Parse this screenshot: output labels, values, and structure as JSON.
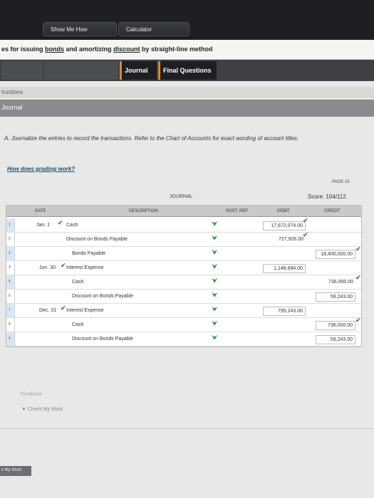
{
  "topbar": {
    "show_me_how": "Show Me How",
    "calculator": "Calculator"
  },
  "title": {
    "prefix": "es for issuing ",
    "bonds": "bonds",
    "middle": " and amortizing ",
    "discount": "discount",
    "suffix": " by straight-line method"
  },
  "tabs": [
    {
      "label": ""
    },
    {
      "label": ""
    },
    {
      "label": "Journal"
    },
    {
      "label": "Final Questions"
    }
  ],
  "instructions_label": "tructions",
  "journal_label": "Journal",
  "instruction": "A. Journalize the entries to record the transactions. Refer to the Chart of Accounts for exact wording of account titles.",
  "grading_link": "How does grading work?",
  "page": "PAGE 10",
  "journal_title": "JOURNAL",
  "score": "Score: 104/112",
  "columns": {
    "date": "DATE",
    "description": "DESCRIPTION",
    "post_ref": "POST. REF.",
    "debit": "DEBIT",
    "credit": "CREDIT"
  },
  "rows": [
    {
      "num": "1",
      "date": "Jan. 1",
      "desc": "Cash",
      "debit": "17,672,074.00",
      "credit": ""
    },
    {
      "num": "2",
      "date": "",
      "desc": "Discount on Bonds Payable",
      "debit": "727,926.00",
      "credit": ""
    },
    {
      "num": "3",
      "date": "",
      "desc": "Bonds Payable",
      "debit": "",
      "credit": "18,400,000.00"
    },
    {
      "num": "4",
      "date": "Jun. 30",
      "desc": "Interest Expense",
      "debit": "1,148,684.00",
      "credit": ""
    },
    {
      "num": "5",
      "date": "",
      "desc": "Cash",
      "debit": "",
      "credit": "736,000.00"
    },
    {
      "num": "6",
      "date": "",
      "desc": "Discount on Bonds Payable",
      "debit": "",
      "credit": "59,243.00"
    },
    {
      "num": "7",
      "date": "Dec. 31",
      "desc": "Interest Expense",
      "debit": "795,243.00",
      "credit": ""
    },
    {
      "num": "8",
      "date": "",
      "desc": "Cash",
      "debit": "",
      "credit": "736,000.00"
    },
    {
      "num": "9",
      "date": "",
      "desc": "Discount on Bonds Payable",
      "debit": "",
      "credit": "59,243.00"
    }
  ],
  "feedback": "Feedback",
  "check_my_work": "▼ Check My Work",
  "bottom_button": "k My Work",
  "colors": {
    "accent_tab": "#e0872a",
    "check": "#2e9a3a",
    "link": "#1a4f7a"
  }
}
